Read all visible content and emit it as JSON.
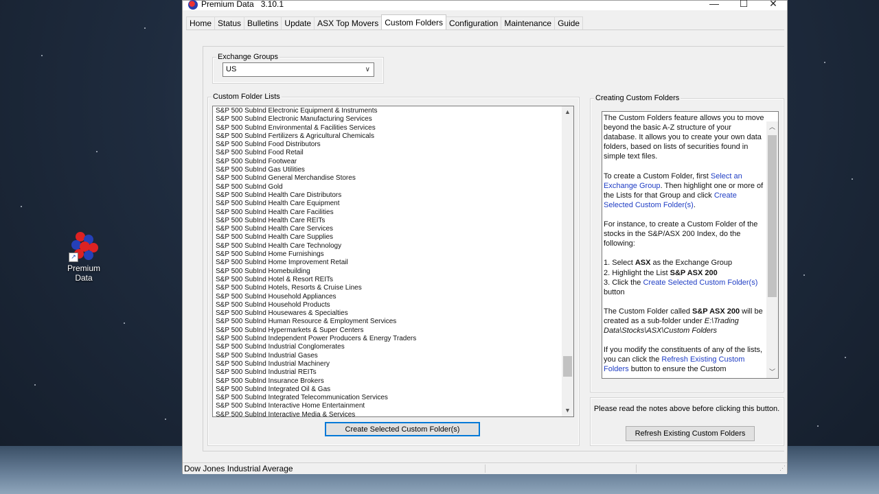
{
  "desktop": {
    "shortcut_label_line1": "Premium",
    "shortcut_label_line2": "Data"
  },
  "window": {
    "app_name": "Premium Data",
    "version": "3.10.1",
    "controls": {
      "minimize": "—",
      "maximize": "☐",
      "close": "✕"
    }
  },
  "tabs": [
    {
      "label": "Home"
    },
    {
      "label": "Status"
    },
    {
      "label": "Bulletins"
    },
    {
      "label": "Update"
    },
    {
      "label": "ASX Top Movers"
    },
    {
      "label": "Custom Folders",
      "active": true
    },
    {
      "label": "Configuration"
    },
    {
      "label": "Maintenance"
    },
    {
      "label": "Guide"
    }
  ],
  "exchange_groups": {
    "legend": "Exchange Groups",
    "selected": "US",
    "arrow": "∨"
  },
  "custom_folder_lists": {
    "legend": "Custom Folder Lists",
    "items": [
      "S&P 500 SubInd Electronic Equipment & Instruments",
      "S&P 500 SubInd Electronic Manufacturing Services",
      "S&P 500 SubInd Environmental & Facilities Services",
      "S&P 500 SubInd Fertilizers & Agricultural Chemicals",
      "S&P 500 SubInd Food Distributors",
      "S&P 500 SubInd Food Retail",
      "S&P 500 SubInd Footwear",
      "S&P 500 SubInd Gas Utilities",
      "S&P 500 SubInd General Merchandise Stores",
      "S&P 500 SubInd Gold",
      "S&P 500 SubInd Health Care Distributors",
      "S&P 500 SubInd Health Care Equipment",
      "S&P 500 SubInd Health Care Facilities",
      "S&P 500 SubInd Health Care REITs",
      "S&P 500 SubInd Health Care Services",
      "S&P 500 SubInd Health Care Supplies",
      "S&P 500 SubInd Health Care Technology",
      "S&P 500 SubInd Home Furnishings",
      "S&P 500 SubInd Home Improvement Retail",
      "S&P 500 SubInd Homebuilding",
      "S&P 500 SubInd Hotel & Resort REITs",
      "S&P 500 SubInd Hotels, Resorts & Cruise Lines",
      "S&P 500 SubInd Household Appliances",
      "S&P 500 SubInd Household Products",
      "S&P 500 SubInd Housewares & Specialties",
      "S&P 500 SubInd Human Resource & Employment Services",
      "S&P 500 SubInd Hypermarkets & Super Centers",
      "S&P 500 SubInd Independent Power Producers & Energy Traders",
      "S&P 500 SubInd Industrial Conglomerates",
      "S&P 500 SubInd Industrial Gases",
      "S&P 500 SubInd Industrial Machinery",
      "S&P 500 SubInd Industrial REITs",
      "S&P 500 SubInd Insurance Brokers",
      "S&P 500 SubInd Integrated Oil & Gas",
      "S&P 500 SubInd Integrated Telecommunication Services",
      "S&P 500 SubInd Interactive Home Entertainment",
      "S&P 500 SubInd Interactive Media & Services"
    ],
    "create_button": "Create Selected Custom Folder(s)"
  },
  "creating_custom_folders": {
    "legend": "Creating Custom Folders",
    "p1": "The Custom Folders feature allows you to move beyond the basic A-Z structure of your database. It allows you to create your own data folders, based on lists of securities found in simple text files.",
    "p2a": "To create a Custom Folder, first ",
    "p2_link1": "Select an Exchange Group",
    "p2b": ". Then highlight one or more of the Lists for that Group and click ",
    "p2_link2": "Create Selected Custom Folder(s)",
    "p2c": ".",
    "p3": "For instance, to create a Custom Folder of the stocks in the S&P/ASX 200 Index, do the following:",
    "step1a": "1. Select ",
    "step1b": "ASX",
    "step1c": " as the Exchange Group",
    "step2a": "2. Highlight the List ",
    "step2b": "S&P ASX 200",
    "step3a": "3. Click the ",
    "step3_link": "Create Selected Custom Folder(s)",
    "step3b": " button",
    "p4a": "The Custom Folder called ",
    "p4b": "S&P ASX 200",
    "p4c": " will be created as a sub-folder under ",
    "p4_path": "E:\\Trading Data\\Stocks\\ASX\\Custom Folders",
    "p5a": "If you modify the constituents of any of the lists, you can click the ",
    "p5_link": "Refresh Existing Custom Folders",
    "p5b": " button to ensure the Custom"
  },
  "refresh": {
    "hint": "Please read the notes above before clicking this button.",
    "button": "Refresh Existing Custom Folders"
  },
  "statusbar": {
    "text": "Dow Jones Industrial Average"
  },
  "scroll_glyphs": {
    "up": "▲",
    "down": "▼",
    "up_chevron": "︿",
    "down_chevron": "﹀"
  }
}
